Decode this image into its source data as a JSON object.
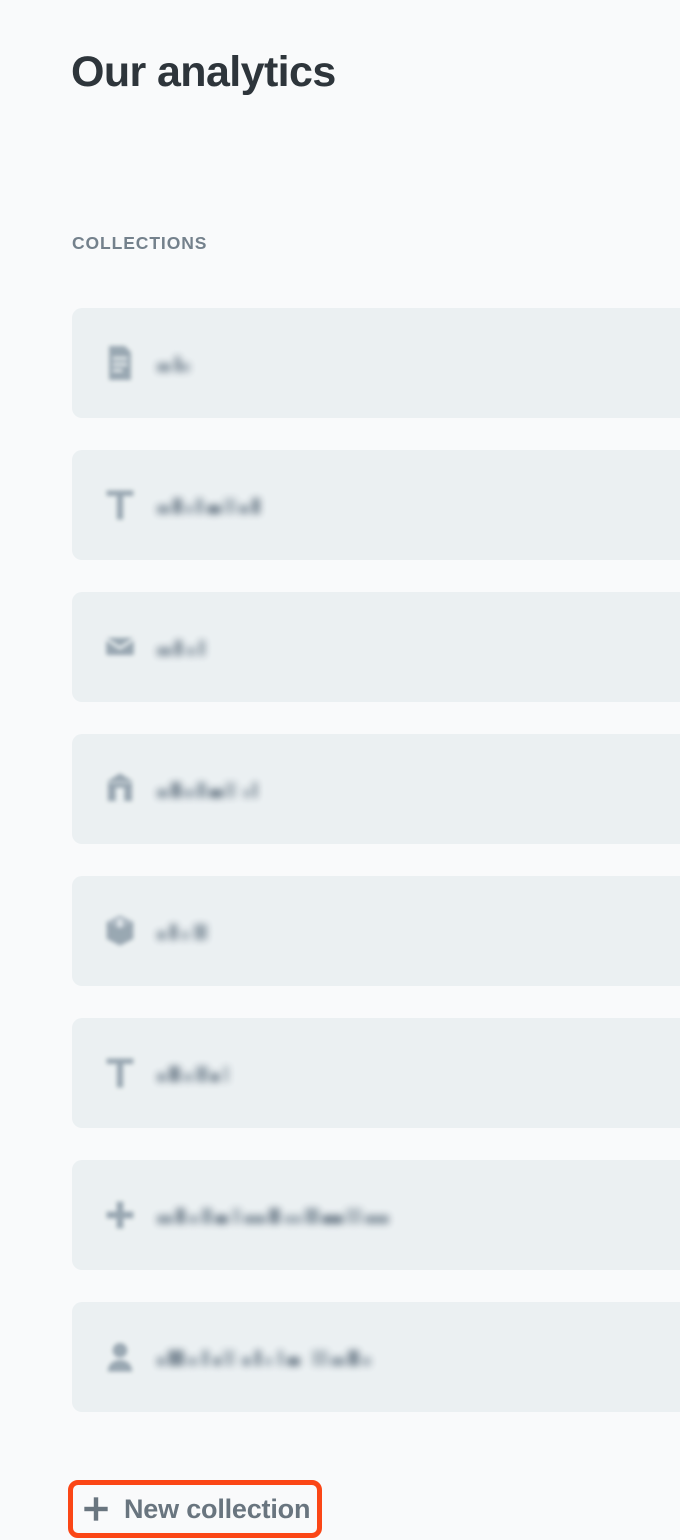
{
  "page": {
    "title": "Our analytics",
    "background_color": "#F9FAFB"
  },
  "section": {
    "header": "COLLECTIONS",
    "row_background_color": "#EBF0F2"
  },
  "collections": [
    {
      "icon": "document-icon",
      "label": "",
      "label_redacted": true,
      "redacted_widths": [
        14,
        5,
        10
      ],
      "redacted_gaps": [
        4,
        0
      ]
    },
    {
      "icon": "text-icon",
      "label": "",
      "label_redacted": true,
      "redacted_widths": [
        13,
        9,
        8,
        7,
        14,
        12,
        10,
        8
      ],
      "redacted_gaps": [
        3,
        3,
        3,
        4,
        3,
        3,
        3
      ]
    },
    {
      "icon": "mail-icon",
      "label": "",
      "label_redacted": true,
      "redacted_widths": [
        15,
        7,
        10,
        6
      ],
      "redacted_gaps": [
        3,
        4,
        3
      ]
    },
    {
      "icon": "bank-icon",
      "label": "",
      "label_redacted": true,
      "redacted_widths": [
        11,
        10,
        12,
        9,
        14,
        11,
        5,
        4
      ],
      "redacted_gaps": [
        3,
        2,
        2,
        3,
        2,
        8,
        4
      ]
    },
    {
      "icon": "box-icon",
      "label": "",
      "label_redacted": true,
      "redacted_widths": [
        9,
        7,
        8,
        13
      ],
      "redacted_gaps": [
        4,
        4,
        5
      ]
    },
    {
      "icon": "text-icon",
      "label": "",
      "label_redacted": true,
      "redacted_widths": [
        9,
        11,
        10,
        12,
        8,
        6
      ],
      "redacted_gaps": [
        3,
        3,
        3,
        3,
        4
      ]
    },
    {
      "icon": "plus-cross-icon",
      "label": "",
      "label_redacted": true,
      "redacted_widths": [
        16,
        9,
        11,
        10,
        13,
        9,
        22,
        11,
        18,
        14,
        21,
        16,
        24
      ],
      "redacted_gaps": [
        3,
        3,
        3,
        3,
        4,
        3,
        3,
        4,
        3,
        3,
        3,
        3
      ]
    },
    {
      "icon": "person-icon",
      "label": "",
      "label_redacted": true,
      "redacted_widths": [
        8,
        16,
        11,
        7,
        6,
        12,
        9,
        6,
        7,
        5,
        13,
        16,
        14,
        11,
        9
      ],
      "redacted_gaps": [
        3,
        3,
        4,
        5,
        3,
        7,
        4,
        4,
        6,
        4,
        12,
        3,
        3,
        3
      ]
    }
  ],
  "new_collection_button": {
    "label": "New collection",
    "icon": "plus-icon",
    "text_color": "#69757F",
    "highlight_color": "#FB4616",
    "highlighted": true
  }
}
